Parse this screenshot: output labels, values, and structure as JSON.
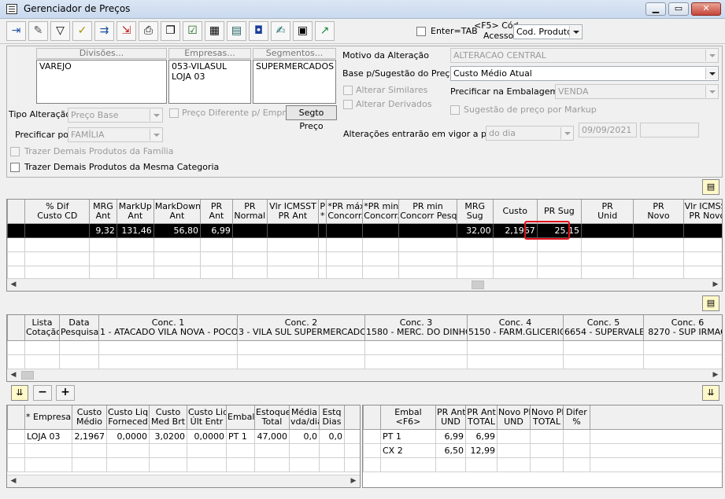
{
  "window": {
    "title": "Gerenciador de Preços"
  },
  "toolbar": {
    "enter_tab_label": "Enter=TAB",
    "f5_label": "<F5> Cód",
    "acesso_label": "Acesso",
    "cod_select": "Cod. Produto"
  },
  "filters": {
    "divisoes_label": "Divisões...",
    "divisoes_items": [
      "VAREJO"
    ],
    "empresas_label": "Empresas...",
    "empresas_items": [
      "053-VILASUL",
      "LOJA 03"
    ],
    "segmentos_label": "Segmentos...",
    "segmentos_items": [
      "SUPERMERCADOS"
    ],
    "tipo_alteracao_label": "Tipo Alteração",
    "tipo_alteracao_value": "Preço Base",
    "preco_diferente_label": "Preço Diferente p/ Empresa",
    "segto_preco_button": "Segto Preço",
    "precificar_por_label": "Precificar por",
    "precificar_por_value": "FAMÍLIA",
    "trazer_familia_label": "Trazer Demais Produtos da Família",
    "trazer_categoria_label": "Trazer Demais Produtos da Mesma Categoria",
    "motivo_label": "Motivo da Alteração",
    "motivo_value": "ALTERACAO CENTRAL",
    "base_label": "Base p/Sugestão do Preço",
    "base_value": "Custo Médio Atual",
    "alterar_similares_label": "Alterar Similares",
    "alterar_derivados_label": "Alterar Derivados",
    "precificar_embalagem_label": "Precificar na Embalagem",
    "precificar_embalagem_value": "VENDA",
    "sugestao_markup_label": "Sugestão de preço por Markup",
    "vigor_label": "Alterações entrarão em vigor a partir",
    "vigor_value": "do dia",
    "vigor_date": "09/09/2021",
    "vigor_extra": ""
  },
  "main_grid": {
    "headers": [
      "% Dif\nCusto CD",
      "MRG\nAnt",
      "MarkUp\nAnt",
      "MarkDown\nAnt",
      "PR\nAnt",
      "PR\nNormal",
      "Vlr ICMSST\nPR Ant",
      "P\n*",
      "*PR máx\nConcorr.",
      "*PR min\nConcorr.",
      "PR min\nConcorr Pesq",
      "MRG\nSug",
      "Custo",
      "PR Sug",
      "PR\nUnid",
      "PR\nNovo",
      "Vlr ICMSST\nPR Novo"
    ],
    "rows": [
      [
        "",
        "9,32",
        "131,46",
        "56,80",
        "6,99",
        "",
        "",
        "",
        "",
        "",
        "",
        "32,00",
        "2,1967",
        "25,15",
        "",
        "",
        ""
      ]
    ]
  },
  "conc_grid": {
    "headers": [
      "Lista\nCotação",
      "Data\nPesquisa",
      "Conc. 1\n1 - ATACADO VILA NOVA - POCOS",
      "Conc. 2\n3 - VILA SUL SUPERMERCADO",
      "Conc. 3\n1580 - MERC. DO DINHO",
      "Conc. 4\n5150 - FARM.GLICERIO",
      "Conc. 5\n6654 - SUPERVALE",
      "Conc. 6\n8270 - SUP IRMAO"
    ]
  },
  "emp_grid": {
    "headers": [
      "* Empresa",
      "Custo\nMédio",
      "Custo Liq\nForneced",
      "Custo\nMed Brt",
      "Custo Liq\nÚlt Entr",
      "Embal",
      "Estoque\nTotal",
      "Média\nvda/dia",
      "Estq\nDias"
    ],
    "rows": [
      [
        "LOJA 03",
        "2,1967",
        "0,0000",
        "3,0200",
        "0,0000",
        "PT 1",
        "47,000",
        "0,0",
        "0,0"
      ]
    ]
  },
  "embal_grid": {
    "headers": [
      "Embal\n<F6>",
      "PR Ant\nUND",
      "PR Ant\nTOTAL",
      "Novo PR\nUND",
      "Novo PR\nTOTAL",
      "Difer\n%"
    ],
    "rows": [
      [
        "PT 1",
        "6,99",
        "6,99",
        "",
        "",
        ""
      ],
      [
        "CX 2",
        "6,50",
        "12,99",
        "",
        "",
        ""
      ]
    ]
  },
  "buttons": {
    "minus": "−",
    "plus": "+"
  }
}
